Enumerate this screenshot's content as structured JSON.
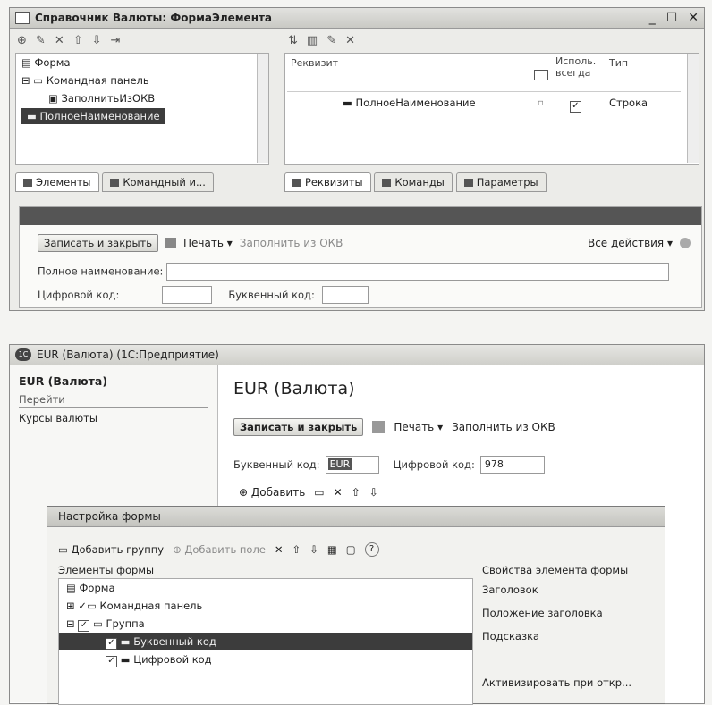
{
  "win1": {
    "title": "Справочник Валюты: ФормаЭлемента",
    "tree": {
      "items": [
        "Форма",
        "Командная панель",
        "ЗаполнитьИзОКВ",
        "ПолноеНаименование"
      ]
    },
    "left_tabs": [
      "Элементы",
      "Командный и..."
    ],
    "grid": {
      "headers": [
        "Реквизит",
        "Исполь. всегда",
        "Тип"
      ],
      "row": {
        "name": "ПолноеНаименование",
        "type": "Строка"
      }
    },
    "right_tabs": [
      "Реквизиты",
      "Команды",
      "Параметры"
    ],
    "preview": {
      "save_close": "Записать и закрыть",
      "print": "Печать",
      "fill_okv": "Заполнить из ОКВ",
      "all_actions": "Все действия",
      "full_name_label": "Полное наименование:",
      "digit_code_label": "Цифровой код:",
      "letter_code_label": "Буквенный код:"
    }
  },
  "win2": {
    "title": "EUR (Валюта)  (1С:Предприятие)",
    "icon_text": "1С",
    "nav": {
      "title": "EUR (Валюта)",
      "goto": "Перейти",
      "rate": "Курсы валюты"
    },
    "page_title": "EUR (Валюта)",
    "save_close": "Записать и закрыть",
    "print": "Печать",
    "fill_okv": "Заполнить из ОКВ",
    "letter_code_label": "Буквенный код:",
    "letter_code_value": "EUR",
    "digit_code_label": "Цифровой код:",
    "digit_code_value": "978",
    "add_label": "Добавить"
  },
  "win3": {
    "title": "Настройка формы",
    "add_group": "Добавить группу",
    "add_field": "Добавить поле",
    "help": "?",
    "left_header": "Элементы формы",
    "right_header": "Свойства элемента формы",
    "tree": [
      "Форма",
      "Командная панель",
      "Группа",
      "Буквенный код",
      "Цифровой код"
    ],
    "props": [
      "Заголовок",
      "Положение заголовка",
      "Подсказка",
      "Активизировать при откр..."
    ]
  }
}
